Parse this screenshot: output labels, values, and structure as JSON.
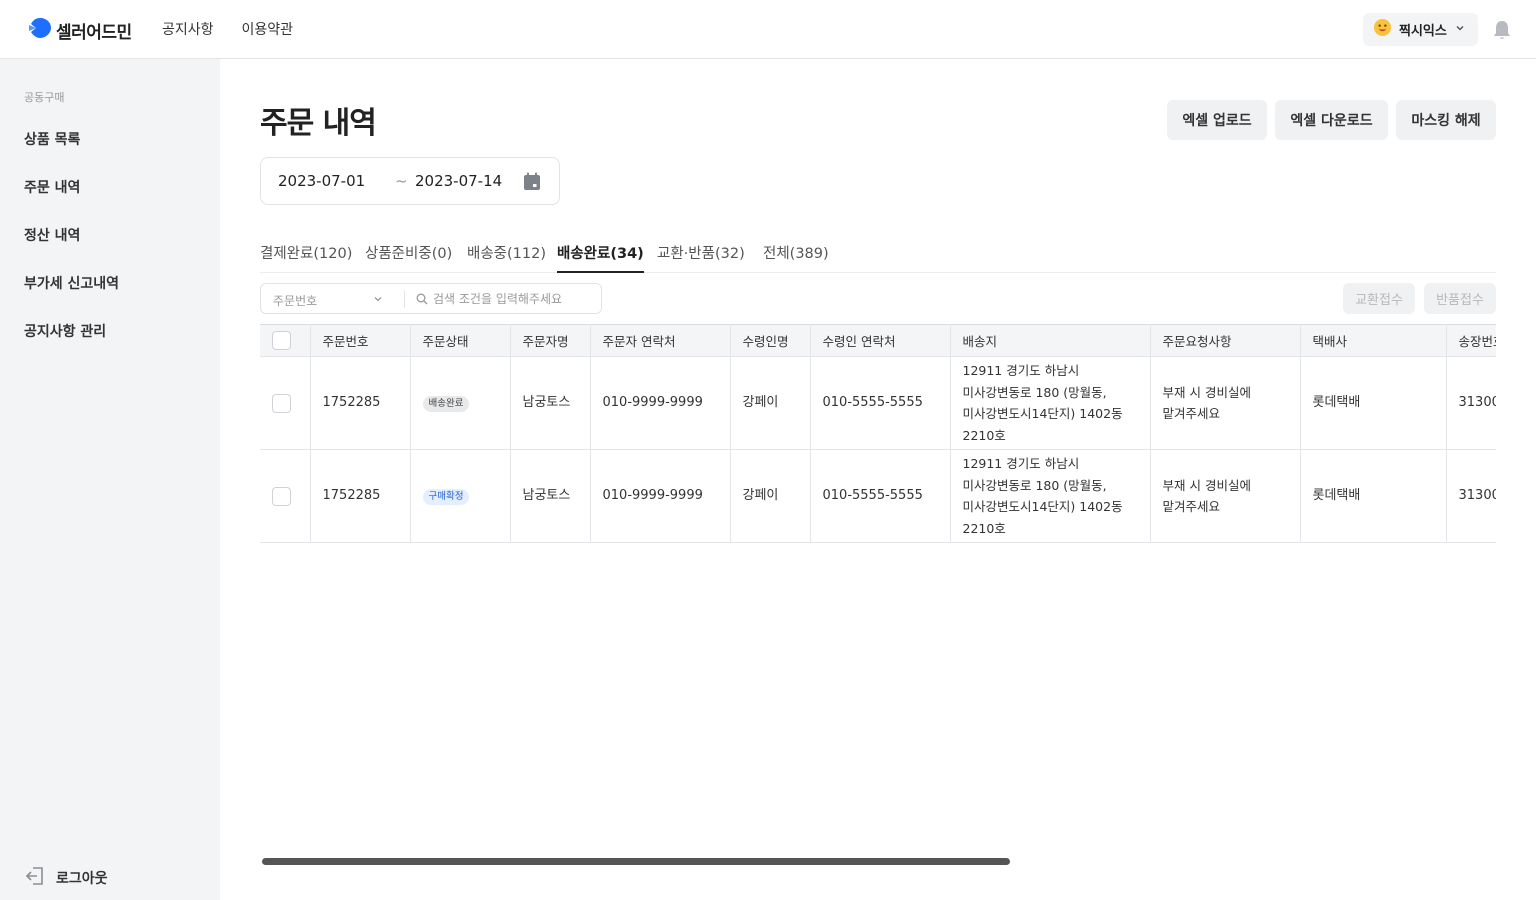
{
  "header": {
    "logo_text": "셀러어드민",
    "nav": [
      "공지사항",
      "이용약관"
    ],
    "user_name": "찍시익스"
  },
  "sidebar": {
    "section": "공동구매",
    "items": [
      {
        "label": "상품 목록"
      },
      {
        "label": "주문 내역"
      },
      {
        "label": "정산 내역"
      },
      {
        "label": "부가세 신고내역"
      },
      {
        "label": "공지사항 관리"
      }
    ],
    "logout": "로그아웃"
  },
  "main": {
    "title": "주문 내역",
    "buttons": {
      "excel_upload": "엑셀 업로드",
      "excel_download": "엑셀 다운로드",
      "unmask": "마스킹 해제"
    },
    "date_range": {
      "start": "2023-07-01",
      "sep": "~",
      "end": "2023-07-14"
    },
    "tabs": [
      {
        "label": "결제완료(120)"
      },
      {
        "label": "상품준비중(0)"
      },
      {
        "label": "배송중(112)"
      },
      {
        "label": "배송완료(34)"
      },
      {
        "label": "교환·반품(32)"
      },
      {
        "label": "전체(389)"
      }
    ],
    "active_tab": "배송완료(34)",
    "filter": {
      "select_label": "주문번호",
      "search_placeholder": "검색 조건을 입력해주세요"
    },
    "actions": {
      "exchange": "교환접수",
      "return": "반품접수"
    },
    "table": {
      "columns": [
        "주문번호",
        "주문상태",
        "주문자명",
        "주문자 연락처",
        "수령인명",
        "수령인 연락처",
        "배송지",
        "주문요청사항",
        "택배사",
        "송장번호"
      ],
      "rows": [
        {
          "order_no": "1752285",
          "status": "배송완료",
          "status_color": "#e8e9eb",
          "buyer": "남궁토스",
          "buyer_phone": "010-9999-9999",
          "receiver": "강페이",
          "receiver_phone": "010-5555-5555",
          "address": [
            "12911 경기도 하남시",
            "미사강변동로 180 (망월동,",
            "미사강변도시14단지) 1402동",
            "2210호"
          ],
          "request": [
            "부재 시 경비실에",
            "맡겨주세요"
          ],
          "courier": "롯데택배",
          "tracking": "31300"
        },
        {
          "order_no": "1752285",
          "status": "구매확정",
          "status_color": "#e3efff",
          "buyer": "남궁토스",
          "buyer_phone": "010-9999-9999",
          "receiver": "강페이",
          "receiver_phone": "010-5555-5555",
          "address": [
            "12911 경기도 하남시",
            "미사강변동로 180 (망월동,",
            "미사강변도시14단지) 1402동",
            "2210호"
          ],
          "request": [
            "부재 시 경비실에",
            "맡겨주세요"
          ],
          "courier": "롯데택배",
          "tracking": "31300"
        }
      ]
    }
  },
  "colors": {
    "brand": "#1e6fff",
    "sidebar_bg": "#f3f4f6",
    "button_bg": "#f0f1f3"
  }
}
